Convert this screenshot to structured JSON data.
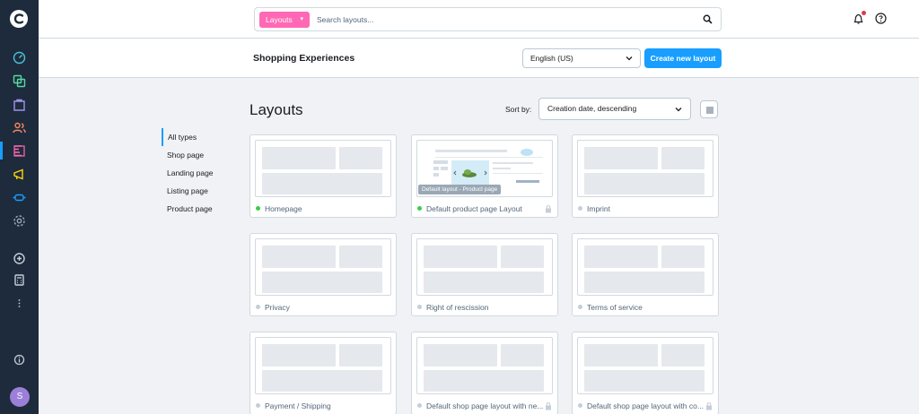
{
  "search": {
    "type_label": "Layouts",
    "placeholder": "Search layouts..."
  },
  "page": {
    "title": "Shopping Experiences",
    "heading": "Layouts"
  },
  "language": {
    "selected": "English (US)"
  },
  "actions": {
    "create_label": "Create new layout"
  },
  "sort": {
    "label": "Sort by:",
    "selected": "Creation date, descending"
  },
  "filters": [
    "All types",
    "Shop page",
    "Landing page",
    "Listing page",
    "Product page"
  ],
  "user": {
    "initial": "S"
  },
  "colors": {
    "accent": "#189eff",
    "pink": "#ff68b4",
    "sidebar": "#1e2b3c",
    "active_dot": "#37d046"
  },
  "cards": [
    {
      "name": "Homepage",
      "status": "active",
      "locked": false
    },
    {
      "name": "Default product page Layout",
      "status": "active",
      "locked": true,
      "badge": "Default layout - Product page"
    },
    {
      "name": "Imprint",
      "status": "inactive",
      "locked": false
    },
    {
      "name": "Privacy",
      "status": "inactive",
      "locked": false
    },
    {
      "name": "Right of rescission",
      "status": "inactive",
      "locked": false
    },
    {
      "name": "Terms of service",
      "status": "inactive",
      "locked": false
    },
    {
      "name": "Payment / Shipping",
      "status": "inactive",
      "locked": false
    },
    {
      "name": "Default shop page layout with ne...",
      "status": "inactive",
      "locked": true
    },
    {
      "name": "Default shop page layout with co...",
      "status": "inactive",
      "locked": true
    }
  ]
}
